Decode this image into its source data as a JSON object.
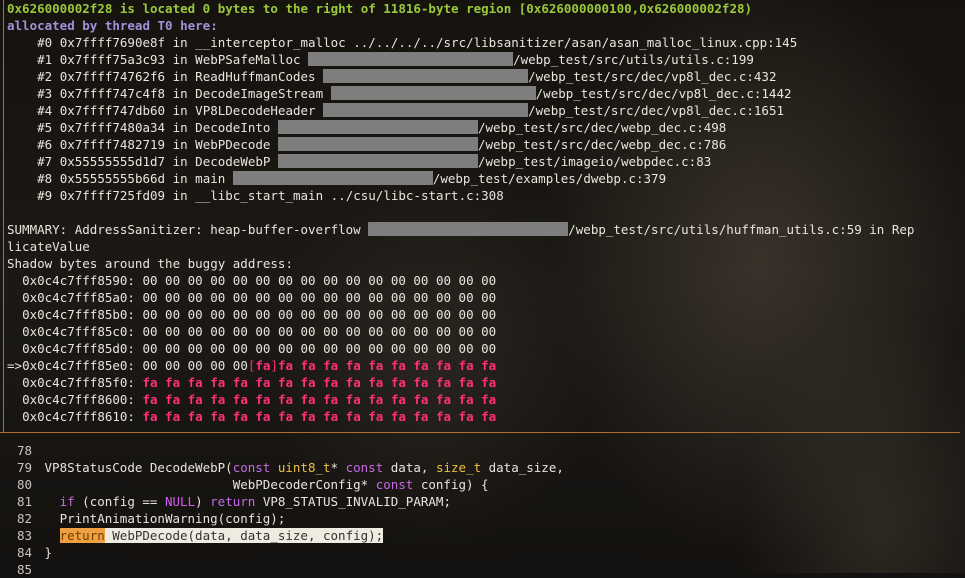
{
  "header": {
    "line1": "0x626000002f28 is located 0 bytes to the right of 11816-byte region [0x626000000100,0x626000002f28)",
    "line2": "allocated by thread T0 here:"
  },
  "frames": [
    {
      "idx": "#0",
      "addr": "0x7ffff7690e8f",
      "fn": "__interceptor_malloc",
      "path": "../../../../src/libsanitizer/asan/asan_malloc_linux.cpp:145"
    },
    {
      "idx": "#1",
      "addr": "0x7ffff75a3c93",
      "fn": "WebPSafeMalloc",
      "path": "/webp_test/src/utils/utils.c:199"
    },
    {
      "idx": "#2",
      "addr": "0x7ffff74762f6",
      "fn": "ReadHuffmanCodes",
      "path": "/webp_test/src/dec/vp8l_dec.c:432"
    },
    {
      "idx": "#3",
      "addr": "0x7ffff747c4f8",
      "fn": "DecodeImageStream",
      "path": "/webp_test/src/dec/vp8l_dec.c:1442"
    },
    {
      "idx": "#4",
      "addr": "0x7ffff747db60",
      "fn": "VP8LDecodeHeader",
      "path": "/webp_test/src/dec/vp8l_dec.c:1651"
    },
    {
      "idx": "#5",
      "addr": "0x7ffff7480a34",
      "fn": "DecodeInto",
      "path": "/webp_test/src/dec/webp_dec.c:498"
    },
    {
      "idx": "#6",
      "addr": "0x7ffff7482719",
      "fn": "WebPDecode",
      "path": "/webp_test/src/dec/webp_dec.c:786"
    },
    {
      "idx": "#7",
      "addr": "0x55555555d1d7",
      "fn": "DecodeWebP",
      "path": "/webp_test/imageio/webpdec.c:83"
    },
    {
      "idx": "#8",
      "addr": "0x55555555b66d",
      "fn": "main",
      "path": "/webp_test/examples/dwebp.c:379"
    },
    {
      "idx": "#9",
      "addr": "0x7ffff725fd09",
      "fn": "__libc_start_main",
      "path": "../csu/libc-start.c:308"
    }
  ],
  "summary": {
    "prefix": "SUMMARY: AddressSanitizer: heap-buffer-overflow",
    "path": "/webp_test/src/utils/huffman_utils.c:59 in Rep",
    "cont": "licateValue"
  },
  "shadow": {
    "title": "Shadow bytes around the buggy address:",
    "rows": [
      {
        "prefix": "  ",
        "addr": "0x0c4c7fff8590:",
        "bytes": "00 00 00 00 00 00 00 00 00 00 00 00 00 00 00 00"
      },
      {
        "prefix": "  ",
        "addr": "0x0c4c7fff85a0:",
        "bytes": "00 00 00 00 00 00 00 00 00 00 00 00 00 00 00 00"
      },
      {
        "prefix": "  ",
        "addr": "0x0c4c7fff85b0:",
        "bytes": "00 00 00 00 00 00 00 00 00 00 00 00 00 00 00 00"
      },
      {
        "prefix": "  ",
        "addr": "0x0c4c7fff85c0:",
        "bytes": "00 00 00 00 00 00 00 00 00 00 00 00 00 00 00 00"
      },
      {
        "prefix": "  ",
        "addr": "0x0c4c7fff85d0:",
        "bytes": "00 00 00 00 00 00 00 00 00 00 00 00 00 00 00 00"
      }
    ],
    "buggy": {
      "prefix": "=>",
      "addr": "0x0c4c7fff85e0:",
      "zeros": "00 00 00 00 00",
      "marked": "fa",
      "rest": "fa fa fa fa fa fa fa fa fa fa"
    },
    "fa_rows": [
      {
        "prefix": "  ",
        "addr": "0x0c4c7fff85f0:",
        "bytes": "fa fa fa fa fa fa fa fa fa fa fa fa fa fa fa fa"
      },
      {
        "prefix": "  ",
        "addr": "0x0c4c7fff8600:",
        "bytes": "fa fa fa fa fa fa fa fa fa fa fa fa fa fa fa fa"
      },
      {
        "prefix": "  ",
        "addr": "0x0c4c7fff8610:",
        "bytes": "fa fa fa fa fa fa fa fa fa fa fa fa fa fa fa fa"
      }
    ]
  },
  "editor": {
    "ln78": "78",
    "ln79": "79",
    "ln80": "80",
    "ln81": "81",
    "ln82": "82",
    "ln83": "83",
    "ln84": "84",
    "ln85": "85",
    "l79": {
      "t1": "VP8StatusCode",
      "fn": " DecodeWebP(",
      "k1": "const",
      "t2": " uint8_t",
      "p1": "* ",
      "k2": "const",
      "p2": " data, ",
      "t3": "size_t",
      "p3": " data_size,"
    },
    "l80": {
      "indent": "                         ",
      "t1": "WebPDecoderConfig",
      "p1": "* ",
      "k1": "const",
      "p2": " config) {"
    },
    "l81": {
      "indent": "  ",
      "k1": "if",
      "p1": " (config == ",
      "n1": "NULL",
      "p2": ") ",
      "k2": "return",
      "p3": " VP8_STATUS_INVALID_PARAM;"
    },
    "l82": {
      "text": "  PrintAnimationWarning(config);"
    },
    "l83": {
      "indent": "  ",
      "k1": "return",
      "p1": " WebPDecode(data, data_size, config);"
    },
    "l84": {
      "text": "}"
    }
  }
}
